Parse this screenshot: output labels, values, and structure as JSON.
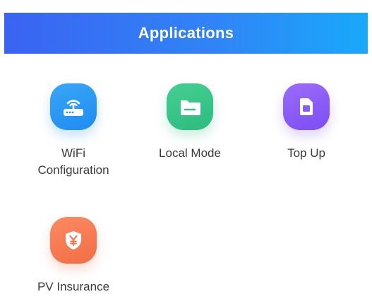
{
  "header": {
    "title": "Applications"
  },
  "apps": [
    {
      "label": "WiFi\nConfiguration",
      "icon": "wifi-router-icon",
      "color": "#2693f3"
    },
    {
      "label": "Local Mode",
      "icon": "folder-icon",
      "color": "#36c285"
    },
    {
      "label": "Top Up",
      "icon": "sim-card-icon",
      "color": "#8a5cf6"
    },
    {
      "label": "PV Insurance",
      "icon": "shield-yen-icon",
      "color": "#f57a52"
    }
  ]
}
